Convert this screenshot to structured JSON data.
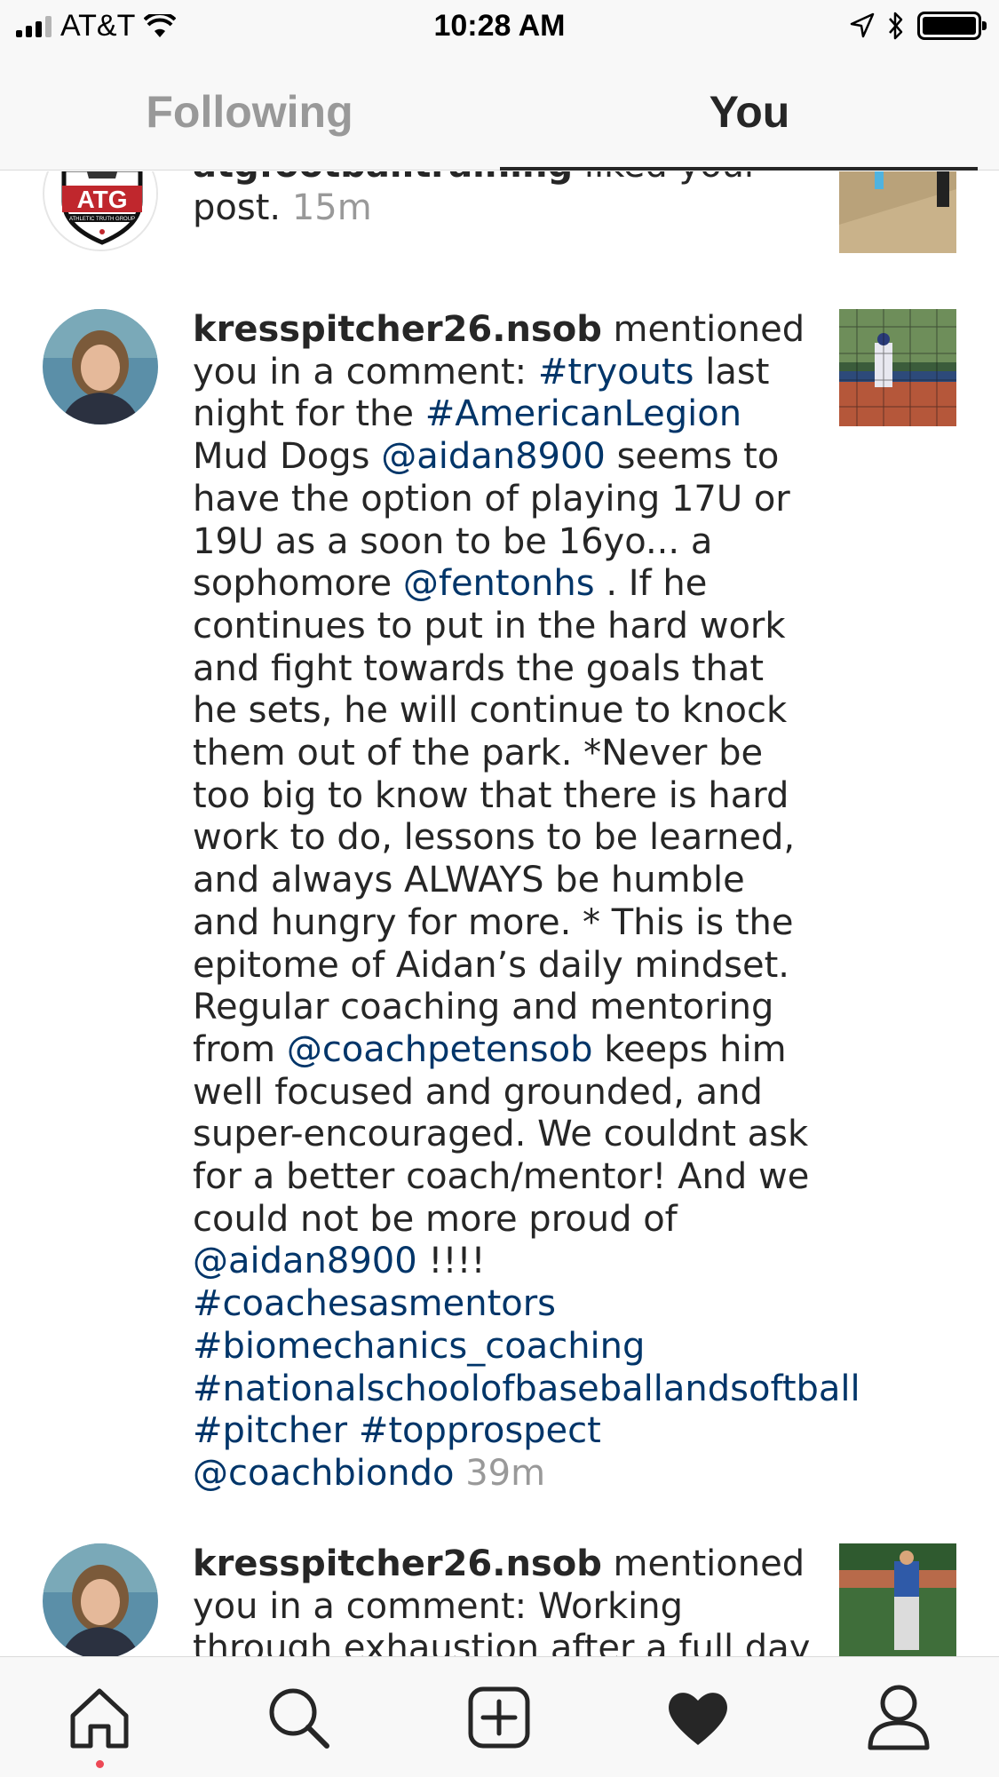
{
  "status_bar": {
    "carrier": "AT&T",
    "time": "10:28 AM",
    "icons": [
      "signal-icon",
      "wifi-icon",
      "location-icon",
      "bluetooth-icon",
      "battery-icon"
    ]
  },
  "tabs": [
    {
      "label": "Following",
      "active": false
    },
    {
      "label": "You",
      "active": true
    }
  ],
  "notifications": [
    {
      "username": "atgfootballtraining",
      "segments": [
        {
          "text": " liked your post. ",
          "type": "text"
        }
      ],
      "time": "15m",
      "avatar": "atg-athletic-truth-group-logo",
      "avatar_lettering": "ATG ATHLETIC TRUTH GROUP"
    },
    {
      "username": "kresspitcher26.nsob",
      "segments": [
        {
          "text": " mentioned you in a comment: ",
          "type": "text"
        },
        {
          "text": "#tryouts",
          "type": "link"
        },
        {
          "text": " last night for the ",
          "type": "text"
        },
        {
          "text": "#AmericanLegion",
          "type": "link"
        },
        {
          "text": " Mud Dogs ",
          "type": "text"
        },
        {
          "text": "@aidan8900",
          "type": "link"
        },
        {
          "text": " seems to have the option of playing 17U or 19U as a soon to be 16yo... a sophomore ",
          "type": "text"
        },
        {
          "text": "@fentonhs",
          "type": "link"
        },
        {
          "text": " .  If he continues to put in the hard work and fight towards the goals that he sets, he will continue to knock them out of the park. *Never be too big to know that there is hard work to do, lessons to be learned, and always ALWAYS be humble and hungry for more. *  This is the epitome of Aidan’s daily mindset. Regular coaching and mentoring from ",
          "type": "text"
        },
        {
          "text": "@coachpetensob",
          "type": "link"
        },
        {
          "text": " keeps him well focused and grounded, and super-encouraged. We couldnt ask for a better coach/mentor!  And we could not be more proud of ",
          "type": "text"
        },
        {
          "text": "@aidan8900",
          "type": "link"
        },
        {
          "text": " !!!! ",
          "type": "text"
        },
        {
          "text": "#coachesasmentors",
          "type": "link"
        },
        {
          "text": " ",
          "type": "text"
        },
        {
          "text": "#biomechanics_coaching",
          "type": "link"
        },
        {
          "text": " ",
          "type": "text"
        },
        {
          "text": "#nationalschoolofbaseballandsoftball",
          "type": "link"
        },
        {
          "text": " ",
          "type": "text"
        },
        {
          "text": "#pitcher",
          "type": "link"
        },
        {
          "text": " ",
          "type": "text"
        },
        {
          "text": "#topprospect",
          "type": "link"
        },
        {
          "text": " ",
          "type": "text"
        },
        {
          "text": "@coachbiondo",
          "type": "link"
        },
        {
          "text": " ",
          "type": "text"
        }
      ],
      "time": "39m",
      "avatar": "user-avatar-photo"
    },
    {
      "username": "kresspitcher26.nsob",
      "segments": [
        {
          "text": " mentioned you in a comment: Working through exhaustion after a full day of",
          "type": "text"
        }
      ],
      "time": "",
      "avatar": "user-avatar-photo"
    }
  ],
  "bottom_nav": [
    {
      "name": "home",
      "icon": "home-icon",
      "active": true
    },
    {
      "name": "search",
      "icon": "search-icon",
      "active": false
    },
    {
      "name": "new-post",
      "icon": "add-post-icon",
      "active": false
    },
    {
      "name": "activity",
      "icon": "heart-icon",
      "active": true
    },
    {
      "name": "profile",
      "icon": "profile-icon",
      "active": false
    }
  ],
  "colors": {
    "link": "#003569",
    "text": "#262626",
    "muted": "#999999",
    "bar_background": "#f8f8f8",
    "notification_dot": "#ed4956",
    "logo_red": "#c0272d"
  }
}
